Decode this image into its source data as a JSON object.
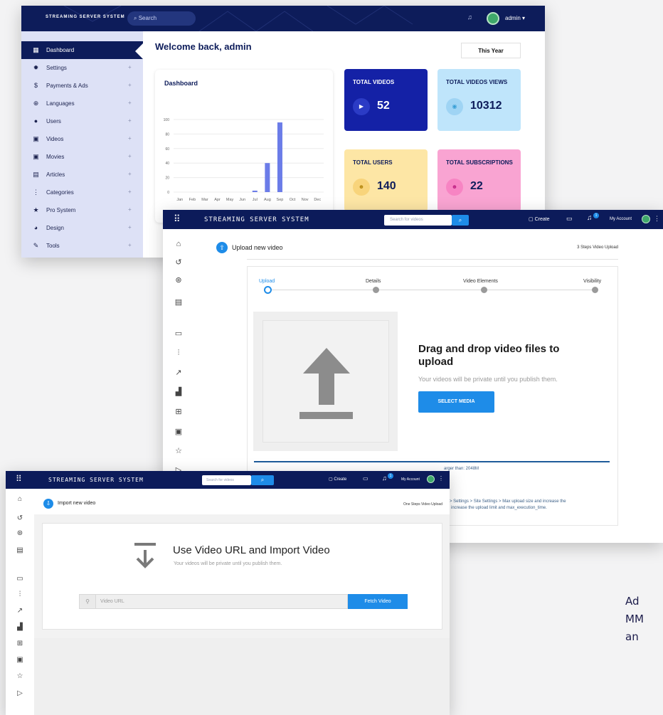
{
  "dashboard": {
    "brand": "STREAMING SERVER SYSTEM",
    "search_placeholder": "Search",
    "user_label": "admin ▾",
    "welcome": "Welcome back, admin",
    "period_button": "This Year",
    "sidebar": [
      {
        "label": "Dashboard",
        "icon": "dashboard-icon",
        "glyph": "▦",
        "expand": ""
      },
      {
        "label": "Settings",
        "icon": "gear-icon",
        "glyph": "✹",
        "expand": "+"
      },
      {
        "label": "Payments & Ads",
        "icon": "dollar-icon",
        "glyph": "$",
        "expand": "+"
      },
      {
        "label": "Languages",
        "icon": "globe-icon",
        "glyph": "⊕",
        "expand": "+"
      },
      {
        "label": "Users",
        "icon": "user-icon",
        "glyph": "●",
        "expand": "+"
      },
      {
        "label": "Videos",
        "icon": "video-icon",
        "glyph": "▣",
        "expand": "+"
      },
      {
        "label": "Movies",
        "icon": "movie-icon",
        "glyph": "▣",
        "expand": "+"
      },
      {
        "label": "Articles",
        "icon": "article-icon",
        "glyph": "▤",
        "expand": "+"
      },
      {
        "label": "Categories",
        "icon": "more-vertical-icon",
        "glyph": "⋮",
        "expand": "+"
      },
      {
        "label": "Pro System",
        "icon": "star-icon",
        "glyph": "★",
        "expand": "+"
      },
      {
        "label": "Design",
        "icon": "palette-icon",
        "glyph": "◕",
        "expand": "+"
      },
      {
        "label": "Tools",
        "icon": "wrench-icon",
        "glyph": "✎",
        "expand": "+"
      }
    ],
    "stats": {
      "videos": {
        "label": "TOTAL VIDEOS",
        "value": "52",
        "color": "#1421a6"
      },
      "views": {
        "label": "TOTAL VIDEOS VIEWS",
        "value": "10312",
        "color": "#bfe5fb"
      },
      "users": {
        "label": "TOTAL USERS",
        "value": "140",
        "color": "#fde6a5"
      },
      "subs": {
        "label": "TOTAL SUBSCRIPTIONS",
        "value": "22",
        "color": "#f9a4d2"
      }
    }
  },
  "chart_data": {
    "type": "bar",
    "title": "Dashboard",
    "categories": [
      "Jan",
      "Feb",
      "Mar",
      "Apr",
      "May",
      "Jun",
      "Jul",
      "Aug",
      "Sep",
      "Oct",
      "Nov",
      "Dec"
    ],
    "values": [
      0,
      0,
      0,
      0,
      0,
      0,
      2,
      40,
      96,
      0,
      0,
      0
    ],
    "ylim": [
      0,
      100
    ],
    "yticks": [
      0,
      20,
      40,
      60,
      80,
      100
    ],
    "grid": true,
    "bar_color": "#6b7ce8"
  },
  "upload": {
    "brand": "STREAMING SERVER SYSTEM",
    "search_placeholder": "Search for videos",
    "create_label": "Create",
    "notif_count": "1",
    "account_label": "My Account",
    "header_title": "Upload new video",
    "header_right": "3 Steps Video Upload",
    "steps": [
      "Upload",
      "Details",
      "Video Elements",
      "Visibility"
    ],
    "drop_title": "Drag and drop video files to upload",
    "drop_subtitle": "Your videos will be private until you publish them.",
    "select_button": "SELECT MEDIA",
    "note_1": "arger than: 2048M",
    "note_2": "gs > Settings > Site Settings > Max upload size and increase the",
    "note_3": "em increase the upload limit and max_execution_time."
  },
  "import": {
    "brand": "STREAMING SERVER SYSTEM",
    "search_placeholder": "Search for videos",
    "create_label": "Create",
    "notif_count": "1",
    "account_label": "My Account",
    "header_title": "Import new video",
    "header_right": "One Steps Video Upload",
    "title": "Use Video URL and Import Video",
    "subtitle": "Your videos will be private until you publish them.",
    "url_placeholder": "Video URL",
    "fetch_button": "Fetch Video"
  },
  "caption_fragment": [
    "Ad",
    "MM",
    "an"
  ]
}
